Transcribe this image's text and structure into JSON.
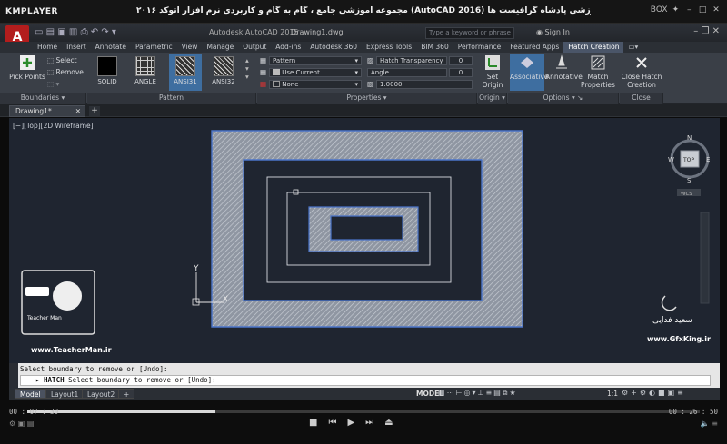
{
  "player": {
    "name": "KMPLAYER",
    "title": "مجموعه آموزشی جامع ، گام به گام و کاربردی نرم افزار  اتوکد ۲۰۱۶ (AutoCAD 2016)  مدرس : سعید فدایی (تیچرمن ) گروه آموزشی پادشاه گرافیست ها",
    "box_label": "BOX",
    "time_elapsed": "00 : 07 : 30",
    "time_total": "00 : 26 : 50",
    "progress": 0.28
  },
  "acad": {
    "app_letter": "A",
    "app_name": "Autodesk AutoCAD 2015",
    "drawing_name": "Drawing1.dwg",
    "search_placeholder": "Type a keyword or phrase",
    "sign_in": "Sign In"
  },
  "ribbon_tabs": [
    "Home",
    "Insert",
    "Annotate",
    "Parametric",
    "View",
    "Manage",
    "Output",
    "Add-ins",
    "Autodesk 360",
    "Express Tools",
    "BIM 360",
    "Performance",
    "Featured Apps",
    "Hatch Creation"
  ],
  "active_tab_index": 13,
  "boundaries": {
    "pick_points": "Pick Points",
    "select": "Select",
    "remove": "Remove",
    "title": "Boundaries"
  },
  "patterns": {
    "items": [
      "SOLID",
      "ANGLE",
      "ANSI31",
      "ANSI32"
    ],
    "selected": "ANSI31",
    "title": "Pattern"
  },
  "properties": {
    "type": "Pattern",
    "color": "Use Current",
    "background": "None",
    "transparency_label": "Hatch Transparency",
    "transparency_value": "0",
    "angle_label": "Angle",
    "angle_value": "0",
    "scale_value": "1.0000",
    "title": "Properties"
  },
  "origin": {
    "set_origin": "Set Origin",
    "title": "Origin"
  },
  "options": {
    "associative": "Associative",
    "annotative": "Annotative",
    "match": "Match Properties",
    "title": "Options"
  },
  "close": {
    "label": "Close Hatch Creation",
    "title": "Close"
  },
  "file_tab": "Drawing1*",
  "viewport_label": "[−][Top][2D Wireframe]",
  "viewcube": {
    "n": "N",
    "s": "S",
    "e": "E",
    "w": "W",
    "top": "TOP",
    "wcs": "WCS"
  },
  "ucs": {
    "x": "X",
    "y": "Y"
  },
  "command": {
    "history": "Select boundary to remove or [Undo]:",
    "prompt_cmd": "HATCH",
    "prompt_text": "Select boundary to remove or [Undo]:"
  },
  "layout_tabs": [
    "Model",
    "Layout1",
    "Layout2"
  ],
  "status": {
    "model": "MODEL",
    "scale": "1:1"
  },
  "watermarks": {
    "site": "www.TeacherMan.ir",
    "gfx": "www.GfxKing.ir",
    "name": "سعید فدایی",
    "logo_text": "Teacher Man"
  },
  "colors": {
    "hatch_blue": "#4a74c9",
    "canvas_bg": "#1f2530",
    "ribbon_bg": "#3a3f47"
  }
}
